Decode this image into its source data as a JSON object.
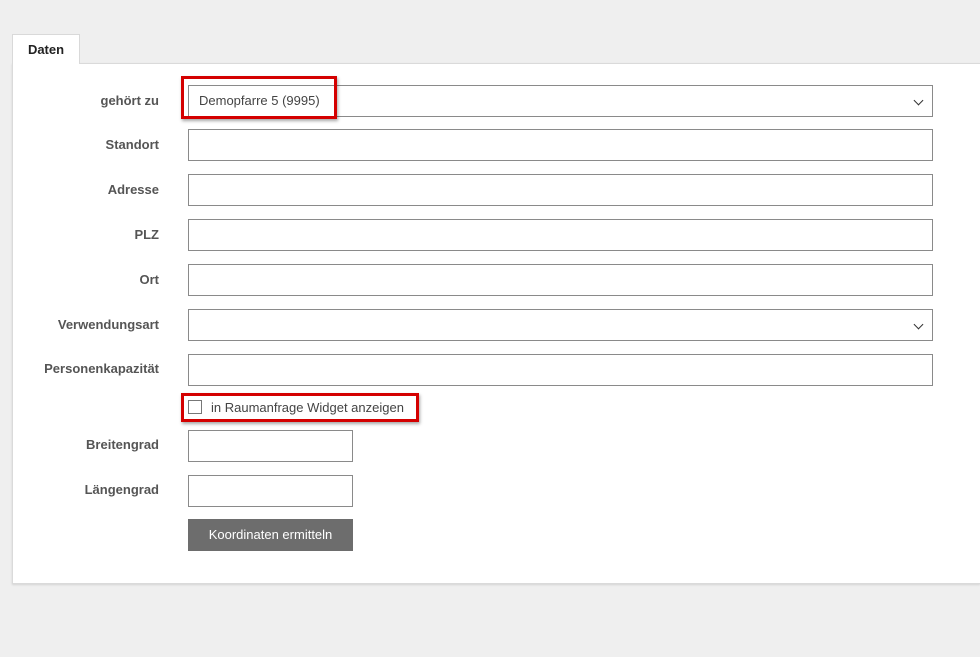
{
  "tabs": [
    {
      "label": "Daten",
      "active": true
    }
  ],
  "form": {
    "gehoert_zu": {
      "label": "gehört zu",
      "value": "Demopfarre 5 (9995)"
    },
    "standort": {
      "label": "Standort",
      "value": ""
    },
    "adresse": {
      "label": "Adresse",
      "value": ""
    },
    "plz": {
      "label": "PLZ",
      "value": ""
    },
    "ort": {
      "label": "Ort",
      "value": ""
    },
    "verwendungsart": {
      "label": "Verwendungsart",
      "value": ""
    },
    "personenkapazitaet": {
      "label": "Personenkapazität",
      "value": ""
    },
    "widget_checkbox": {
      "label": "in Raumanfrage Widget anzeigen",
      "checked": false
    },
    "breitengrad": {
      "label": "Breitengrad",
      "value": ""
    },
    "laengengrad": {
      "label": "Längengrad",
      "value": ""
    },
    "koordinaten_button": {
      "label": "Koordinaten ermitteln"
    }
  },
  "colors": {
    "highlight": "#d40000",
    "button_bg": "#6d6d6d",
    "page_bg": "#efefef"
  }
}
